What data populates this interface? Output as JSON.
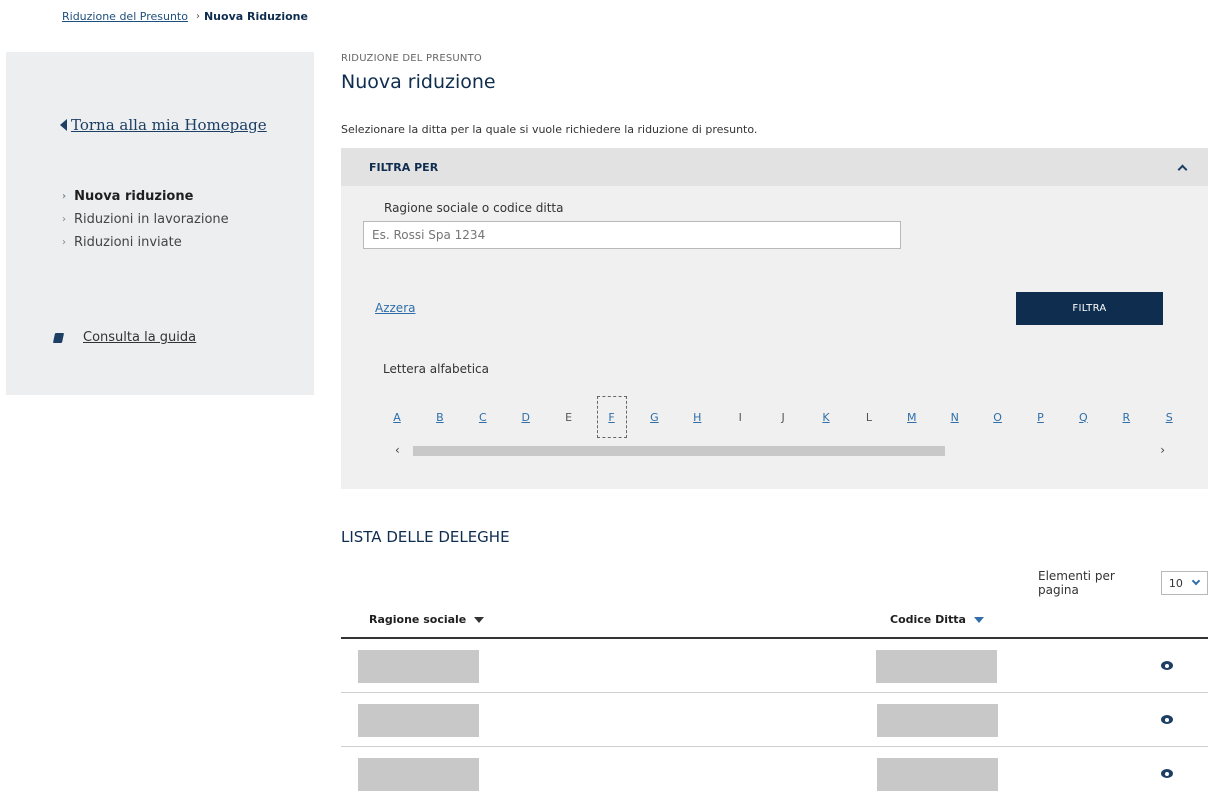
{
  "breadcrumb": {
    "parent": "Riduzione del Presunto",
    "current": "Nuova Riduzione"
  },
  "sidebar": {
    "back_label": "Torna alla mia Homepage",
    "items": [
      {
        "label": "Nuova riduzione",
        "active": true
      },
      {
        "label": "Riduzioni in lavorazione",
        "active": false
      },
      {
        "label": "Riduzioni inviate",
        "active": false
      }
    ],
    "guide_label": "Consulta la guida"
  },
  "header": {
    "section": "RIDUZIONE DEL PRESUNTO",
    "title": "Nuova riduzione",
    "intro": "Selezionare la ditta per la quale si vuole richiedere la riduzione di presunto."
  },
  "filter": {
    "title": "FILTRA PER",
    "field_label": "Ragione sociale o codice ditta",
    "field_placeholder": "Es. Rossi Spa 1234",
    "reset_label": "Azzera",
    "submit_label": "FILTRA",
    "alpha_label": "Lettera alfabetica",
    "letters": [
      "A",
      "B",
      "C",
      "D",
      "E",
      "F",
      "G",
      "H",
      "I",
      "J",
      "K",
      "L",
      "M",
      "N",
      "O",
      "P",
      "Q",
      "R",
      "S"
    ],
    "selected_letter": "F",
    "plain_letters": [
      "E",
      "I",
      "J",
      "L"
    ]
  },
  "list": {
    "title": "LISTA DELLE DELEGHE",
    "per_page_label": "Elementi per pagina",
    "per_page_value": "10",
    "columns": {
      "name": "Ragione sociale",
      "code": "Codice Ditta"
    },
    "row_count": 3
  },
  "colors": {
    "primary": "#0f2d4f",
    "link": "#2f6ea8",
    "sidebar_bg": "#eceef0",
    "panel_bg": "#f0f0f0"
  },
  "icons": {
    "view": "eye-icon",
    "guide": "book-icon",
    "back": "triangle-left-icon"
  }
}
